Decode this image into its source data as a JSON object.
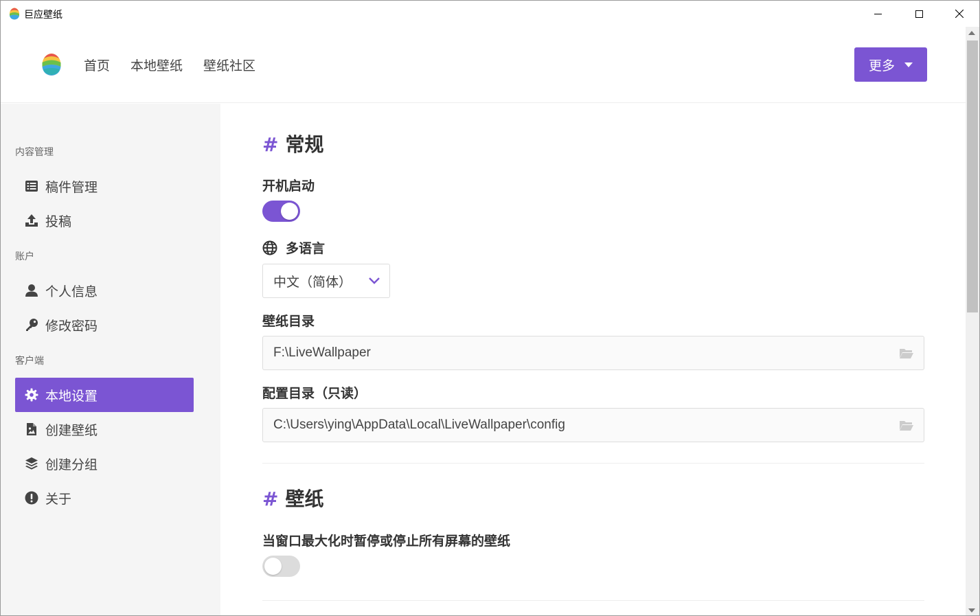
{
  "window": {
    "title": "巨应壁纸"
  },
  "header": {
    "nav": [
      "首页",
      "本地壁纸",
      "壁纸社区"
    ],
    "more_label": "更多"
  },
  "sidebar": {
    "groups": {
      "content": "内容管理",
      "account": "账户",
      "client": "客户端"
    },
    "items": {
      "drafts": "稿件管理",
      "submit": "投稿",
      "profile": "个人信息",
      "password": "修改密码",
      "local_settings": "本地设置",
      "create_wallpaper": "创建壁纸",
      "create_group": "创建分组",
      "about": "关于"
    },
    "active": "local_settings"
  },
  "content": {
    "general": {
      "hash": "#",
      "title": "常规",
      "autostart_label": "开机启动",
      "autostart_on": true,
      "language_label": "多语言",
      "language_value": "中文（简体）",
      "wallpaper_dir_label": "壁纸目录",
      "wallpaper_dir_value": "F:\\LiveWallpaper",
      "config_dir_label": "配置目录（只读）",
      "config_dir_value": "C:\\Users\\ying\\AppData\\Local\\LiveWallpaper\\config"
    },
    "wallpaper": {
      "hash": "#",
      "title": "壁纸",
      "pause_label": "当窗口最大化时暂停或停止所有屏幕的壁纸",
      "pause_on": false
    }
  },
  "colors": {
    "accent": "#7b55d3",
    "sidebar_bg": "#f5f5f5"
  }
}
